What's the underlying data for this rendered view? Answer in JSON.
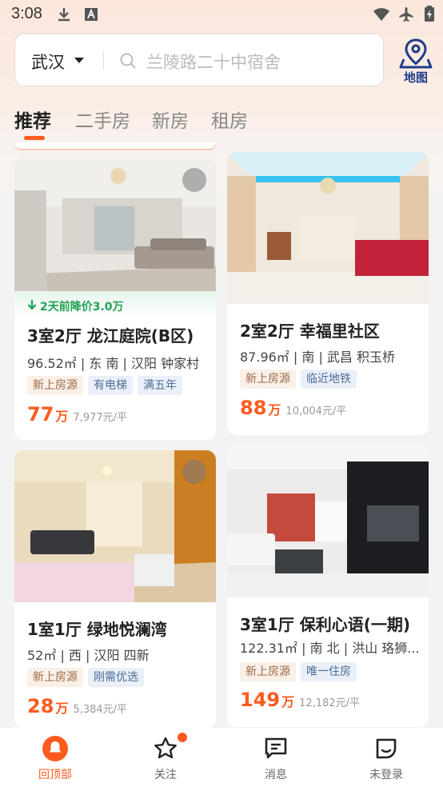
{
  "status_bar": {
    "time": "3:08"
  },
  "search": {
    "city": "武汉",
    "placeholder": "兰陵路二十中宿舍"
  },
  "map_button": {
    "label": "地图"
  },
  "tabs": [
    {
      "label": "推荐",
      "active": true
    },
    {
      "label": "二手房",
      "active": false
    },
    {
      "label": "新房",
      "active": false
    },
    {
      "label": "租房",
      "active": false
    }
  ],
  "listings": [
    {
      "price_drop": "2天前降价3.0万",
      "title": "3室2厅 龙江庭院(B区)",
      "meta": "96.52㎡ | 东 南 | 汉阳 钟家村",
      "tags": [
        "新上房源",
        "有电梯",
        "满五年"
      ],
      "price": "77",
      "price_unit": "万",
      "unit_price": "7,977元/平"
    },
    {
      "title": "2室2厅 幸福里社区",
      "meta": "87.96㎡ | 南 | 武昌 积玉桥",
      "tags": [
        "新上房源",
        "临近地铁"
      ],
      "price": "88",
      "price_unit": "万",
      "unit_price": "10,004元/平"
    },
    {
      "title": "1室1厅 绿地悦澜湾",
      "meta": "52㎡ | 西 | 汉阳 四新",
      "tags": [
        "新上房源",
        "刚需优选"
      ],
      "price": "28",
      "price_unit": "万",
      "unit_price": "5,384元/平"
    },
    {
      "title": "3室1厅 保利心语(一期)",
      "meta": "122.31㎡ | 南 北 | 洪山 珞狮...",
      "tags": [
        "新上房源",
        "唯一住房"
      ],
      "price": "149",
      "price_unit": "万",
      "unit_price": "12,182元/平"
    }
  ],
  "bottom_nav": [
    {
      "label": "回顶部",
      "icon": "home-bell-icon",
      "active": true
    },
    {
      "label": "关注",
      "icon": "star-icon",
      "badge": true
    },
    {
      "label": "消息",
      "icon": "message-icon"
    },
    {
      "label": "未登录",
      "icon": "user-icon"
    }
  ],
  "colors": {
    "accent": "#ff5a1f",
    "price_drop": "#21a156",
    "map_icon": "#1f3c8a"
  }
}
